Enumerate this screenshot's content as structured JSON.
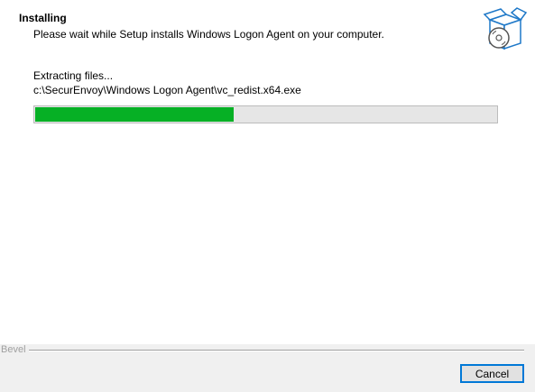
{
  "header": {
    "title": "Installing",
    "subtitle": "Please wait while Setup installs Windows Logon Agent on your computer.",
    "icon": "installer-box-disc-icon"
  },
  "progress": {
    "status": "Extracting files...",
    "path": "c:\\SecurEnvoy\\Windows Logon Agent\\vc_redist.x64.exe",
    "percent": 43,
    "fill_color": "#06b025"
  },
  "footer": {
    "bevel_label": "Bevel",
    "cancel_label": "Cancel",
    "accent_color": "#0078d7"
  }
}
